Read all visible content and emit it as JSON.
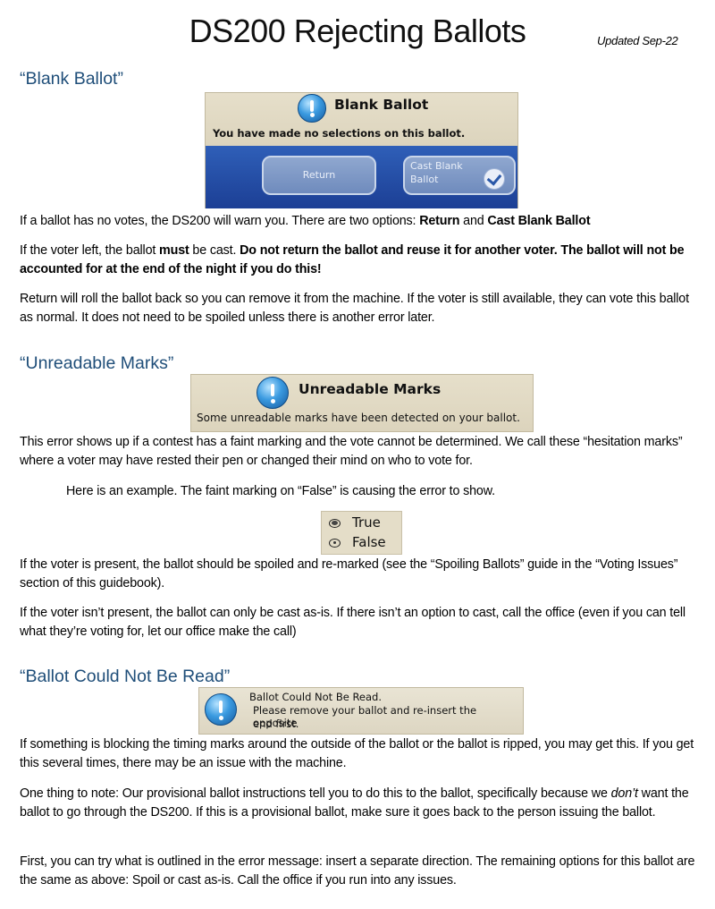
{
  "header": {
    "title": "DS200 Rejecting Ballots",
    "updated": "Updated Sep-22"
  },
  "sections": {
    "blank": {
      "heading": "“Blank Ballot”",
      "screen": {
        "title": "Blank Ballot",
        "message": "You have made no selections on this ballot.",
        "return_button": "Return",
        "cast_button_line1": "Cast Blank",
        "cast_button_line2": "Ballot"
      },
      "p1_text": "If a ballot has no votes, the DS200 will warn you. There are two options: ",
      "p1_opt1": "Return",
      "p1_and": " and ",
      "p1_opt2": "Cast Blank Ballot",
      "p2_text1": "If the voter left, the ballot ",
      "p2_must": "must",
      "p2_text2": " be cast. ",
      "p2_bold": "Do not return the ballot and reuse it for another voter. The ballot will not be accounted for at the end of the night if you do this!",
      "p3": "Return will roll the ballot back so you can remove it from the machine. If the voter is still available, they can vote this ballot as normal. It does not need to be spoiled unless there is another error later."
    },
    "unreadable": {
      "heading": "“Unreadable Marks”",
      "screen": {
        "title": "Unreadable Marks",
        "message": "Some unreadable marks have been detected on your ballot."
      },
      "p1": "This error shows up if a contest has a faint marking and the vote cannot be determined. We call these “hesitation marks” where a voter may have rested their pen or changed their mind on who to vote for.",
      "example": "Here is an example. The faint marking on “False” is causing the error to show.",
      "options": [
        "True",
        "False"
      ],
      "p2": "If the voter is present, the ballot should be spoiled and re-marked (see the “Spoiling Ballots” guide in the “Voting Issues” section of this guidebook).",
      "p3": "If the voter isn’t present, the ballot can only be cast as-is. If there isn’t an option to cast, call the office (even if you can tell what they’re voting for, let our office make the call)"
    },
    "could_not_read": {
      "heading": "“Ballot Could Not Be Read”",
      "screen": {
        "line1": "Ballot Could Not Be Read.",
        "line2": "Please remove your ballot and re-insert the opposite",
        "line3": "end first."
      },
      "p1": "If something is blocking the timing marks around the outside of the ballot or the ballot is ripped, you may get this. If you get this several times, there may be an issue with the machine.",
      "p2_text1": "One thing to note: Our provisional ballot instructions tell you to do this to the ballot, specifically because we ",
      "p2_em": "don’t",
      "p2_text2": " want the ballot to go through the DS200. If this is a provisional ballot, make sure it goes back to the person issuing the ballot.",
      "p3": "First, you can try what is outlined in the error message: insert a separate direction. The remaining options for this ballot are the same as above: Spoil or cast as-is. Call the office if you run into any issues."
    }
  },
  "icons": [
    "info-icon",
    "checkmark-icon"
  ],
  "colors": {
    "heading": "#1f4e79",
    "screen_bg": "#e0d9c4",
    "screen_button_bar": "#2a4fa8"
  }
}
